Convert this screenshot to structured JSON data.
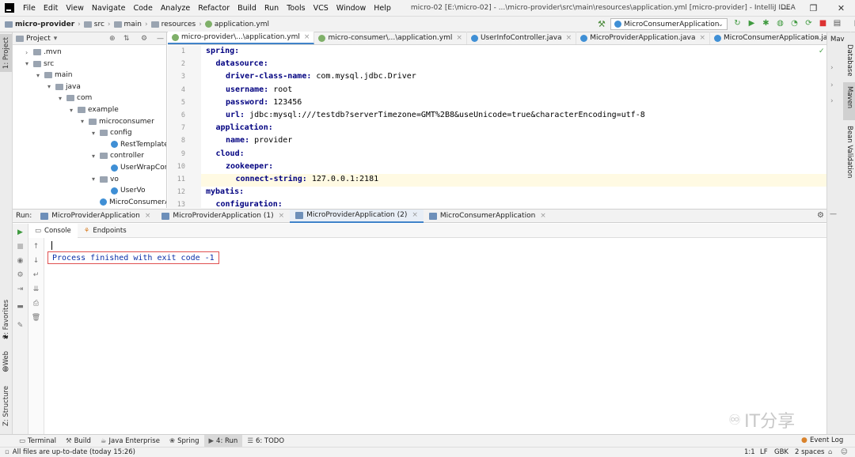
{
  "titlebar": {
    "menu": [
      "File",
      "Edit",
      "View",
      "Navigate",
      "Code",
      "Analyze",
      "Refactor",
      "Build",
      "Run",
      "Tools",
      "VCS",
      "Window",
      "Help"
    ],
    "title": "micro-02 [E:\\micro-02] - ...\\micro-provider\\src\\main\\resources\\application.yml [micro-provider] - IntelliJ IDEA",
    "minimize": "—",
    "maximize": "❐",
    "close": "✕"
  },
  "navbar": {
    "breadcrumbs": [
      "micro-provider",
      "src",
      "main",
      "resources",
      "application.yml"
    ],
    "run_config": "MicroConsumerApplication"
  },
  "left_stripe": {
    "project": "1: Project",
    "favorites": "2: Favorites",
    "web": "Web",
    "structure": "Z: Structure"
  },
  "right_stripe": {
    "tab": "Mav",
    "database": "Database",
    "maven": "Maven",
    "bean": "Bean Validation"
  },
  "project_panel": {
    "title": "Project",
    "tree": [
      {
        "label": ".mvn",
        "indent": 1,
        "icon": "folder"
      },
      {
        "label": "src",
        "indent": 1,
        "icon": "folder"
      },
      {
        "label": "main",
        "indent": 2,
        "icon": "folder"
      },
      {
        "label": "java",
        "indent": 3,
        "icon": "folder"
      },
      {
        "label": "com",
        "indent": 4,
        "icon": "folder"
      },
      {
        "label": "example",
        "indent": 5,
        "icon": "folder"
      },
      {
        "label": "microconsumer",
        "indent": 6,
        "icon": "folder"
      },
      {
        "label": "config",
        "indent": 7,
        "icon": "folder"
      },
      {
        "label": "RestTemplate",
        "indent": 8,
        "icon": "class"
      },
      {
        "label": "controller",
        "indent": 7,
        "icon": "folder"
      },
      {
        "label": "UserWrapCor",
        "indent": 8,
        "icon": "class"
      },
      {
        "label": "vo",
        "indent": 7,
        "icon": "folder"
      },
      {
        "label": "UserVo",
        "indent": 8,
        "icon": "class"
      },
      {
        "label": "MicroConsumerA",
        "indent": 7,
        "icon": "class"
      }
    ]
  },
  "editor_tabs": [
    {
      "label": "micro-provider\\...\\application.yml",
      "icon": "yml",
      "active": true
    },
    {
      "label": "micro-consumer\\...\\application.yml",
      "icon": "yml",
      "active": false
    },
    {
      "label": "UserInfoController.java",
      "icon": "class",
      "active": false
    },
    {
      "label": "MicroProviderApplication.java",
      "icon": "class",
      "active": false
    },
    {
      "label": "MicroConsumerApplication.java",
      "icon": "class",
      "active": false
    }
  ],
  "tab_overflow": "⁴",
  "code_lines": [
    {
      "n": "1",
      "indent": 0,
      "key": "spring:",
      "val": ""
    },
    {
      "n": "2",
      "indent": 1,
      "key": "datasource:",
      "val": ""
    },
    {
      "n": "3",
      "indent": 2,
      "key": "driver-class-name:",
      "val": " com.mysql.jdbc.Driver"
    },
    {
      "n": "4",
      "indent": 2,
      "key": "username:",
      "val": " root"
    },
    {
      "n": "5",
      "indent": 2,
      "key": "password:",
      "val": " 123456"
    },
    {
      "n": "6",
      "indent": 2,
      "key": "url:",
      "val": " jdbc:mysql:///testdb?serverTimezone=GMT%2B8&useUnicode=true&characterEncoding=utf-8"
    },
    {
      "n": "7",
      "indent": 1,
      "key": "application:",
      "val": ""
    },
    {
      "n": "8",
      "indent": 2,
      "key": "name:",
      "val": " provider"
    },
    {
      "n": "9",
      "indent": 1,
      "key": "cloud:",
      "val": ""
    },
    {
      "n": "10",
      "indent": 2,
      "key": "zookeeper:",
      "val": ""
    },
    {
      "n": "11",
      "indent": 3,
      "key": "connect-string:",
      "val": " 127.0.0.1:2181"
    },
    {
      "n": "12",
      "indent": 0,
      "key": "mybatis:",
      "val": ""
    },
    {
      "n": "13",
      "indent": 1,
      "key": "configuration:",
      "val": ""
    }
  ],
  "run_panel": {
    "label": "Run:",
    "tabs": [
      {
        "label": "MicroProviderApplication",
        "active": false
      },
      {
        "label": "MicroProviderApplication (1)",
        "active": false
      },
      {
        "label": "MicroProviderApplication (2)",
        "active": true
      },
      {
        "label": "MicroConsumerApplication",
        "active": false
      }
    ],
    "subtabs": [
      "Console",
      "Endpoints"
    ],
    "console_output": "Process finished with exit code -1"
  },
  "watermark": "IT分享",
  "bottom_tabs": [
    {
      "label": "Terminal",
      "active": false
    },
    {
      "label": "Build",
      "active": false
    },
    {
      "label": "Java Enterprise",
      "active": false
    },
    {
      "label": "Spring",
      "active": false
    },
    {
      "label": "4: Run",
      "active": true
    },
    {
      "label": "6: TODO",
      "active": false
    }
  ],
  "event_log": "Event Log",
  "status": {
    "message": "All files are up-to-date (today 15:26)",
    "position": "1:1",
    "line_sep": "LF",
    "encoding": "GBK",
    "indent": "2 spaces"
  },
  "colors": {
    "accent": "#4083c9",
    "keyword": "#000080",
    "exit_text": "#0a2fa8",
    "exit_border": "#e05050"
  }
}
